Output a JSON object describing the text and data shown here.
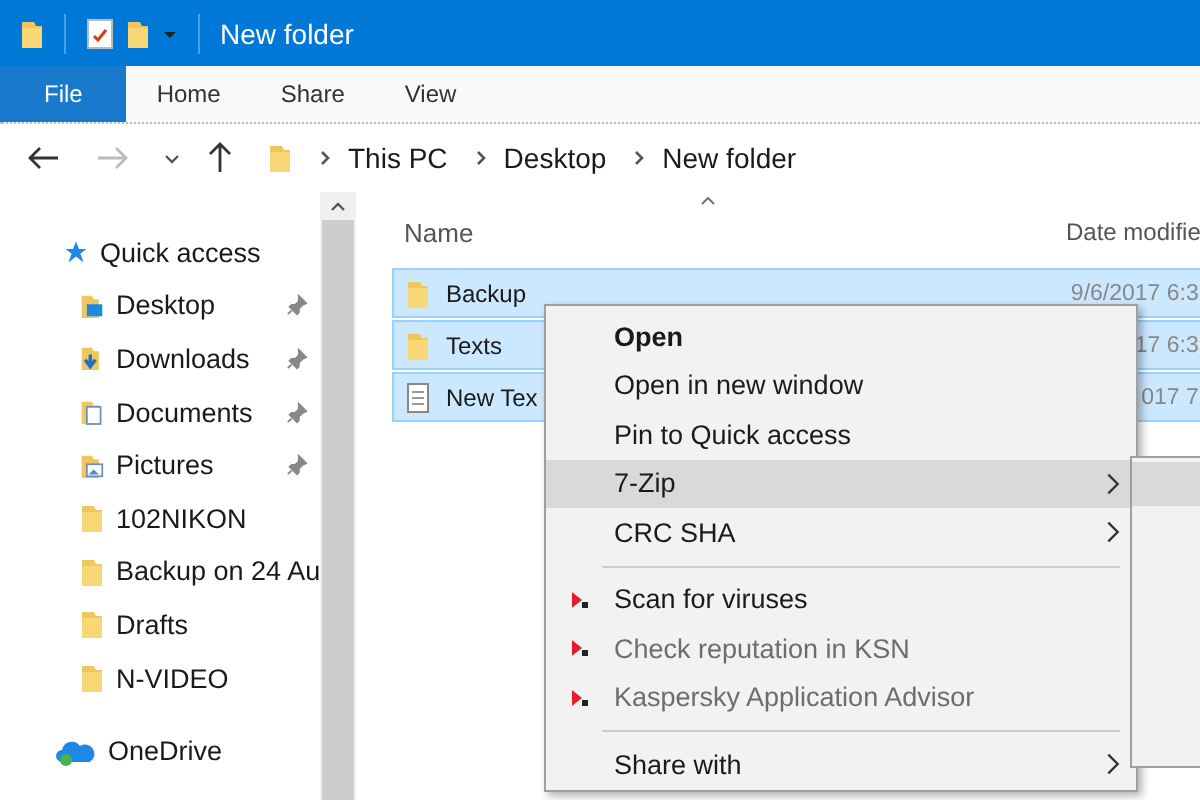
{
  "title_bar": {
    "title": "New folder"
  },
  "ribbon_tabs": [
    {
      "label": "File",
      "kind": "file"
    },
    {
      "label": "Home",
      "kind": "tab"
    },
    {
      "label": "Share",
      "kind": "tab"
    },
    {
      "label": "View",
      "kind": "tab"
    }
  ],
  "breadcrumb": [
    "This PC",
    "Desktop",
    "New folder"
  ],
  "nav": {
    "quick_access": "Quick access",
    "items": [
      {
        "label": "Desktop",
        "kind": "desktop",
        "pinned": true
      },
      {
        "label": "Downloads",
        "kind": "downloads",
        "pinned": true
      },
      {
        "label": "Documents",
        "kind": "documents",
        "pinned": true
      },
      {
        "label": "Pictures",
        "kind": "pictures",
        "pinned": true
      },
      {
        "label": "102NIKON",
        "kind": "folder",
        "pinned": false
      },
      {
        "label": "Backup on 24 Au",
        "kind": "folder",
        "pinned": false
      },
      {
        "label": "Drafts",
        "kind": "folder",
        "pinned": false
      },
      {
        "label": "N-VIDEO",
        "kind": "folder",
        "pinned": false
      }
    ],
    "onedrive": "OneDrive"
  },
  "columns": [
    "Name",
    "Date modifie"
  ],
  "files": [
    {
      "name": "Backup",
      "kind": "folder",
      "date": "9/6/2017 6:3",
      "selected": true
    },
    {
      "name": "Texts",
      "kind": "folder",
      "date": "17 6:3",
      "selected": true
    },
    {
      "name": "New Tex",
      "kind": "text",
      "date": "017 7",
      "selected": true
    }
  ],
  "context_menu": [
    {
      "kind": "item",
      "label": "Open",
      "bold": true,
      "disabled": false,
      "submenu": false,
      "selected": false
    },
    {
      "kind": "item",
      "label": "Open in new window",
      "bold": false,
      "disabled": false,
      "submenu": false,
      "selected": false
    },
    {
      "kind": "item",
      "label": "Pin to Quick access",
      "bold": false,
      "disabled": false,
      "submenu": false,
      "selected": false
    },
    {
      "kind": "item",
      "label": "7-Zip",
      "bold": false,
      "disabled": false,
      "submenu": true,
      "selected": true
    },
    {
      "kind": "item",
      "label": "CRC SHA",
      "bold": false,
      "disabled": false,
      "submenu": true,
      "selected": false
    },
    {
      "kind": "separator"
    },
    {
      "kind": "kaspersky",
      "label": "Scan for viruses",
      "bold": false,
      "disabled": false,
      "submenu": false,
      "selected": false
    },
    {
      "kind": "kaspersky",
      "label": "Check reputation in KSN",
      "bold": false,
      "disabled": true,
      "submenu": false,
      "selected": false
    },
    {
      "kind": "kaspersky",
      "label": "Kaspersky Application Advisor",
      "bold": false,
      "disabled": true,
      "submenu": false,
      "selected": false
    },
    {
      "kind": "separator"
    },
    {
      "kind": "item",
      "label": "Share with",
      "bold": false,
      "disabled": false,
      "submenu": true,
      "selected": false
    }
  ]
}
